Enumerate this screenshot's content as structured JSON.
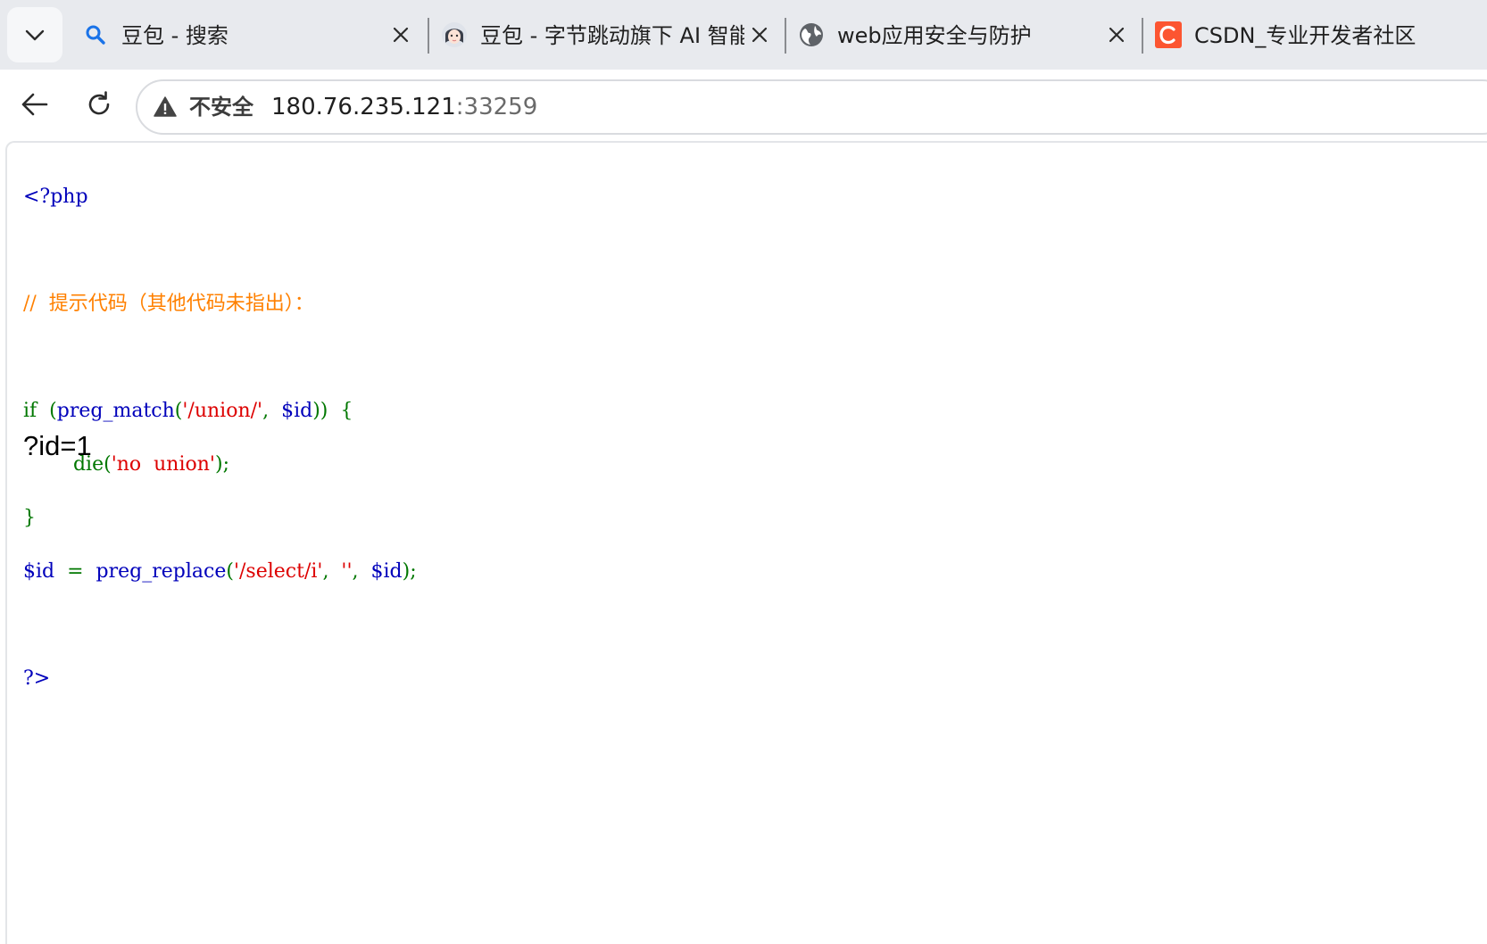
{
  "tabs": [
    {
      "title": "豆包 - 搜索",
      "favicon": "search-icon",
      "closable": true
    },
    {
      "title": "豆包 - 字节跳动旗下 AI 智能助手",
      "favicon": "doubao-avatar-icon",
      "closable": true
    },
    {
      "title": "web应用安全与防护",
      "favicon": "globe-icon",
      "closable": true
    },
    {
      "title": "CSDN_专业开发者社区",
      "favicon": "csdn-logo-icon",
      "closable": false
    }
  ],
  "address_bar": {
    "security_label": "不安全",
    "host": "180.76.235.121",
    "port": ":33259"
  },
  "source_code": {
    "php_open": "<?php",
    "comment": "//  提示代码（其他代码未指出）：",
    "if_kw": "if",
    "if_open_paren": "  (",
    "preg_match_fn": "preg_match",
    "paren_open": "(",
    "union_pattern": "'/union/'",
    "comma": ",  ",
    "id_var": "$id",
    "close_if": "))  {",
    "indent": "        ",
    "die_fn": "die(",
    "die_msg": "'no  union'",
    "die_close": ");",
    "close_brace": "}",
    "assign_var": "$id",
    "assign_op": "  =  ",
    "preg_replace_fn": "preg_replace",
    "select_pattern": "'/select/i'",
    "empty_string": "''",
    "replace_close": ");",
    "php_close": "?>"
  },
  "page_output": "?id=1",
  "colors": {
    "php_default": "#0000bb",
    "php_keyword": "#007700",
    "php_comment": "#ff8000",
    "php_string": "#dd0000",
    "csdn_brand": "#fc5531"
  }
}
